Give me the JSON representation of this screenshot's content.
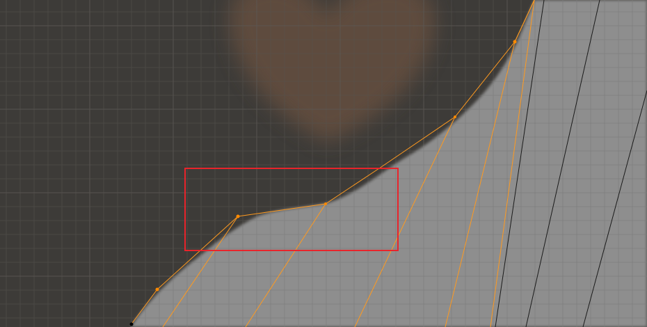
{
  "viewport": {
    "mode": "edit",
    "view": "orthographic"
  },
  "colors": {
    "background_image": "#3d3b38",
    "mesh_fill": "#8e8e8e",
    "grid_line": "#555350",
    "grid_line_on_mesh": "#7d7d7d",
    "edge_selected": "#ff9a1f",
    "vertex_selected": "#ff8a00",
    "vertex_unselected": "#000000",
    "edge_unselected": "#1a1a1a",
    "heart_tint": "#6b5140",
    "annotation_box": "#e8242b"
  },
  "icons": {
    "vertex": "vertex-dot-icon",
    "annotation": "rectangle-outline"
  }
}
